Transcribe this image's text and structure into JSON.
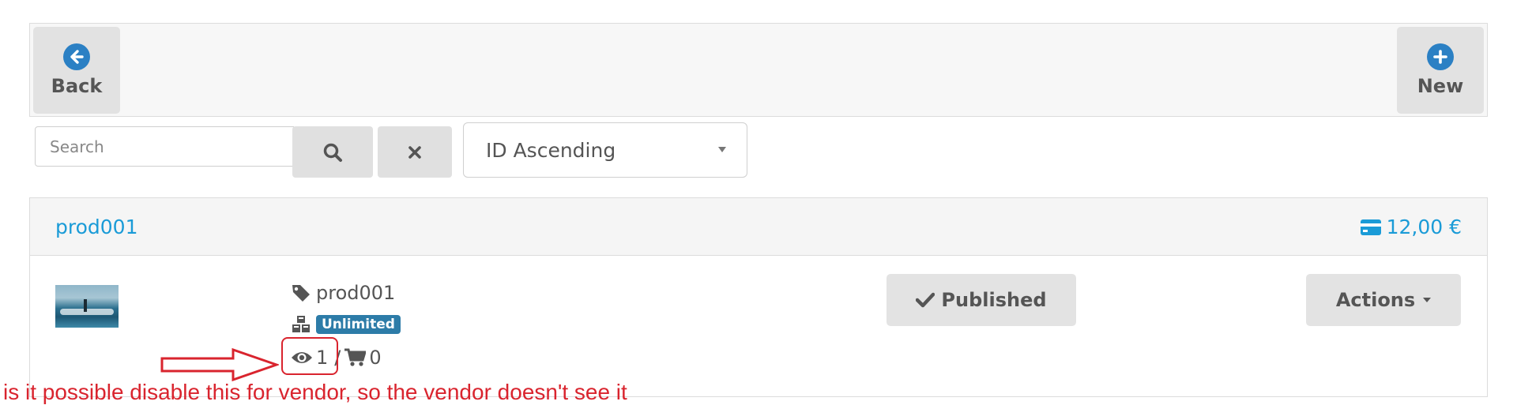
{
  "toolbar": {
    "back_label": "Back",
    "new_label": "New"
  },
  "filters": {
    "search_placeholder": "Search",
    "search_value": "",
    "sort_selected": "ID Ascending"
  },
  "product": {
    "title": "prod001",
    "price": "12,00 €",
    "sku": "prod001",
    "stock_badge": "Unlimited",
    "views": "1",
    "separator": "/",
    "cart_count": "0",
    "status_label": "Published",
    "actions_label": "Actions"
  },
  "annotation": {
    "text": "is it possible disable this for vendor, so the vendor doesn't see it"
  },
  "colors": {
    "accent_blue": "#1a9bd7",
    "icon_blue": "#2b80c4",
    "badge_blue": "#2d7ca8",
    "annotation_red": "#d9242e"
  }
}
